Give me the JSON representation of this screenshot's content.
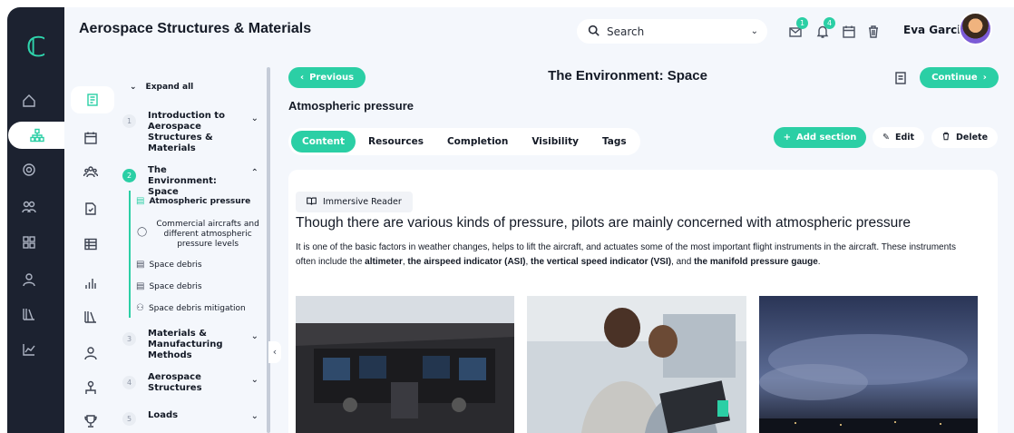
{
  "app": {
    "title": "Aerospace Structures & Materials",
    "logo_icon": "brand-logo",
    "accent": "#2bcfa5",
    "rail_bg": "#1c2230"
  },
  "header": {
    "search_placeholder": "Search",
    "messages_badge": "1",
    "notifications_badge": "4",
    "user_name": "Eva Garcia"
  },
  "rail_icons": [
    "home-icon",
    "sitemap-icon",
    "target-icon",
    "users-icon",
    "grid-icon",
    "user-icon",
    "library-icon",
    "chart-line-icon"
  ],
  "column_icons": [
    "book-icon",
    "calendar-icon",
    "team-icon",
    "file-check-icon",
    "table-icon",
    "bar-chart-icon",
    "library-icon",
    "user-icon",
    "org-chart-icon",
    "trophy-icon"
  ],
  "outline": {
    "expand_all": "Expand all",
    "modules": [
      {
        "num": "1",
        "label": "Introduction to Aerospace Structures & Materials",
        "expanded": false
      },
      {
        "num": "2",
        "label": "The Environment: Space",
        "expanded": true
      },
      {
        "num": "3",
        "label": "Materials & Manufacturing Methods",
        "expanded": false
      },
      {
        "num": "4",
        "label": "Aerospace Structures",
        "expanded": false
      },
      {
        "num": "5",
        "label": "Loads",
        "expanded": false
      }
    ],
    "topics": [
      {
        "label": "Atmospheric pressure",
        "icon": "page-icon"
      },
      {
        "label": "Commercial aircrafts and different atmospheric pressure levels",
        "icon": "chat-icon"
      },
      {
        "label": "Space debris",
        "icon": "document-icon"
      },
      {
        "label": "Space debris",
        "icon": "document-icon"
      },
      {
        "label": "Space debris mitigation",
        "icon": "group-icon"
      }
    ]
  },
  "main": {
    "previous_label": "Previous",
    "continue_label": "Continue",
    "page_title": "The Environment: Space",
    "section_title": "Atmospheric pressure",
    "tabs": [
      "Content",
      "Resources",
      "Completion",
      "Visibility",
      "Tags"
    ],
    "active_tab": "Content",
    "add_section_label": "Add section",
    "edit_label": "Edit",
    "delete_label": "Delete",
    "immersive_reader_label": "Immersive Reader",
    "headline": "Though there are various kinds of pressure, pilots are mainly concerned with atmospheric pressure",
    "paragraph": {
      "intro": "It is one of the basic factors in weather changes, helps to lift the aircraft, and actuates some of the most important flight instruments in the aircraft. These instruments often include the ",
      "term1": "altimeter",
      "sep1": ", ",
      "term2": "the airspeed indicator (ASI)",
      "sep2": ", ",
      "term3": "the vertical speed indicator (VSI)",
      "sep3": ", and ",
      "term4": "the manifold pressure gauge",
      "end": "."
    },
    "images": [
      "cockpit-photo",
      "students-laptop-photo",
      "storm-sky-photo"
    ]
  }
}
